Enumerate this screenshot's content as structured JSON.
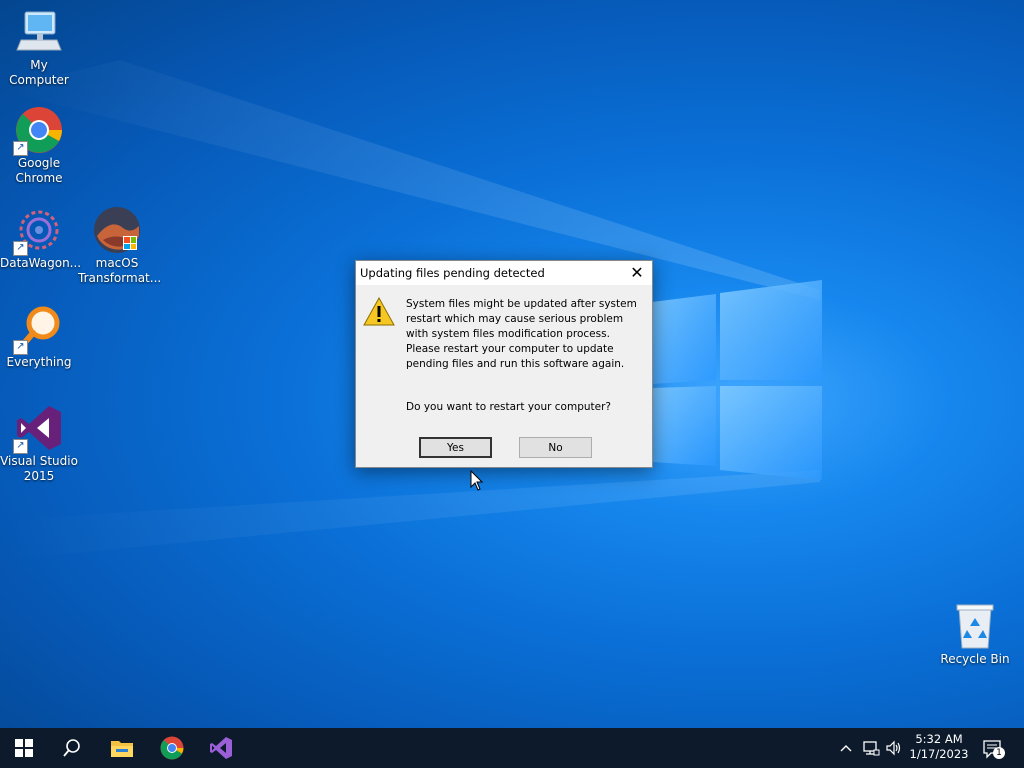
{
  "desktop": {
    "icons": [
      {
        "label": "My Computer",
        "icon": "monitor-icon"
      },
      {
        "label": "Google Chrome",
        "icon": "chrome-icon"
      },
      {
        "label": "DataWagon...",
        "icon": "datawagon-icon"
      },
      {
        "label": "macOS Transformat...",
        "icon": "macos-icon"
      },
      {
        "label": "Everything",
        "icon": "magnifier-icon"
      },
      {
        "label": "Visual Studio 2015",
        "icon": "visual-studio-icon"
      },
      {
        "label": "Recycle Bin",
        "icon": "recycle-bin-icon"
      }
    ]
  },
  "dialog": {
    "title": "Updating files pending detected",
    "message": "System files might be updated after system restart which may cause serious problem with system files modification process. Please restart your computer to update pending files and run this software again.",
    "question": "Do you want to restart your computer?",
    "yes_label": "Yes",
    "no_label": "No",
    "icon": "warning-icon"
  },
  "taskbar": {
    "pinned": [
      "start-icon",
      "search-icon",
      "file-explorer-icon",
      "chrome-icon",
      "visual-studio-icon"
    ],
    "time": "5:32 AM",
    "date": "1/17/2023",
    "notification_count": "1"
  },
  "colors": {
    "desktop_blue": "#0a6fd6",
    "taskbar": "#0c1a2c",
    "dialog_bg": "#f0f0f0"
  }
}
